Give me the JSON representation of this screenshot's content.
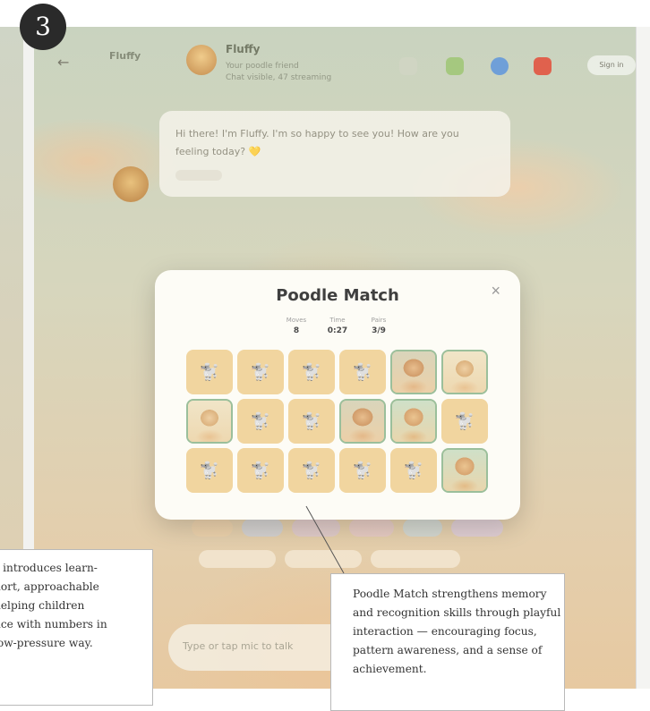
{
  "step_badge": "3",
  "background_app": {
    "back_arrow": "←",
    "app_name": "Fluffy",
    "pet_name": "Fluffy",
    "pet_status_line1": "Your poodle friend",
    "pet_status_line2": "Chat visible, 47 streaming",
    "header_button_label": "Sign in",
    "chat_message": "Hi there! I'm Fluffy. I'm so happy to see you! How are you feeling today? 💛",
    "input_placeholder": "Type or tap mic to talk"
  },
  "game": {
    "title": "Poodle Match",
    "close_label": "×",
    "stats": [
      {
        "label": "Moves",
        "value": "8"
      },
      {
        "label": "Time",
        "value": "0:27"
      },
      {
        "label": "Pairs",
        "value": "3/9"
      }
    ],
    "cards": [
      {
        "state": "back",
        "icon": "🐩"
      },
      {
        "state": "back",
        "icon": "🐩"
      },
      {
        "state": "back",
        "icon": "🐩"
      },
      {
        "state": "back",
        "icon": "🐩"
      },
      {
        "state": "face",
        "variant": "poodle-cream",
        "icon": ""
      },
      {
        "state": "face",
        "variant": "poodle-light",
        "icon": ""
      },
      {
        "state": "face",
        "variant": "poodle-light",
        "icon": ""
      },
      {
        "state": "back",
        "icon": "🐩"
      },
      {
        "state": "back",
        "icon": "🐩"
      },
      {
        "state": "face",
        "variant": "poodle-cream",
        "icon": ""
      },
      {
        "state": "face",
        "variant": "poodle-green",
        "icon": ""
      },
      {
        "state": "back",
        "icon": "🐩"
      },
      {
        "state": "back",
        "icon": "🐩"
      },
      {
        "state": "back",
        "icon": "🐩"
      },
      {
        "state": "back",
        "icon": "🐩"
      },
      {
        "state": "back",
        "icon": "🐩"
      },
      {
        "state": "back",
        "icon": "🐩"
      },
      {
        "state": "face",
        "variant": "poodle-green",
        "icon": ""
      }
    ]
  },
  "annotations": {
    "left_text": "s introduces learn-\nhort, approachable\nhelping children\nnce with numbers in\nlow-pressure way.",
    "right_text": "Poodle Match strengthens memory and recognition skills through playful interaction — encouraging focus, pattern awareness, and a sense of achievement."
  }
}
